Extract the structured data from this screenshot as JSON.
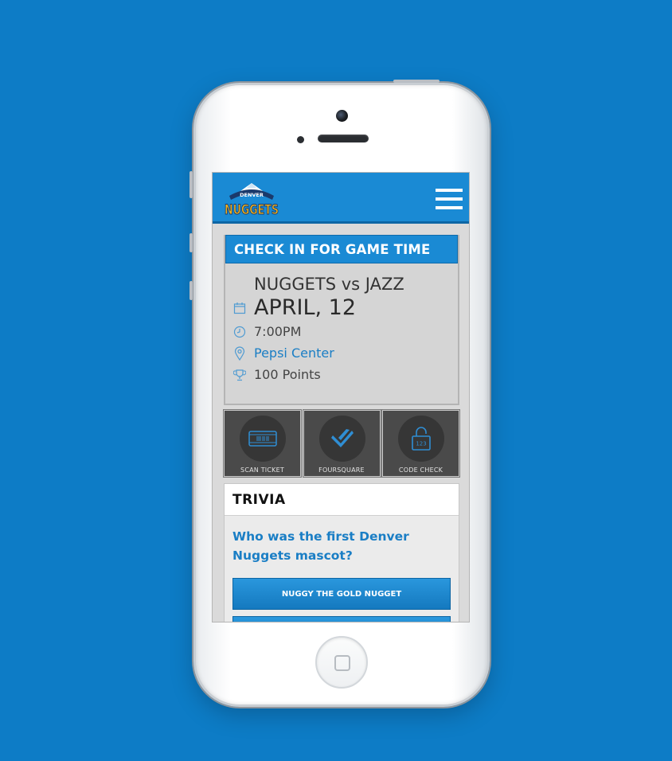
{
  "header": {
    "logo_top": "DENVER",
    "logo_main": "NUGGETS"
  },
  "checkin": {
    "title": "CHECK IN FOR GAME TIME",
    "matchup": "NUGGETS vs JAZZ",
    "date": "APRIL, 12",
    "time": "7:00PM",
    "venue": "Pepsi Center",
    "points": "100 Points"
  },
  "actions": [
    {
      "label": "SCAN TICKET",
      "icon": "ticket-icon"
    },
    {
      "label": "FOURSQUARE",
      "icon": "foursquare-icon"
    },
    {
      "label": "CODE CHECK",
      "icon": "lock-icon",
      "code": "123"
    }
  ],
  "trivia": {
    "title": "TRIVIA",
    "question": "Who was the first Denver Nuggets mascot?",
    "answers": [
      "NUGGY THE GOLD NUGGET",
      ""
    ]
  },
  "colors": {
    "background": "#0d7cc6",
    "brand_blue": "#1a8ad4",
    "brand_gold": "#f2b21a"
  }
}
